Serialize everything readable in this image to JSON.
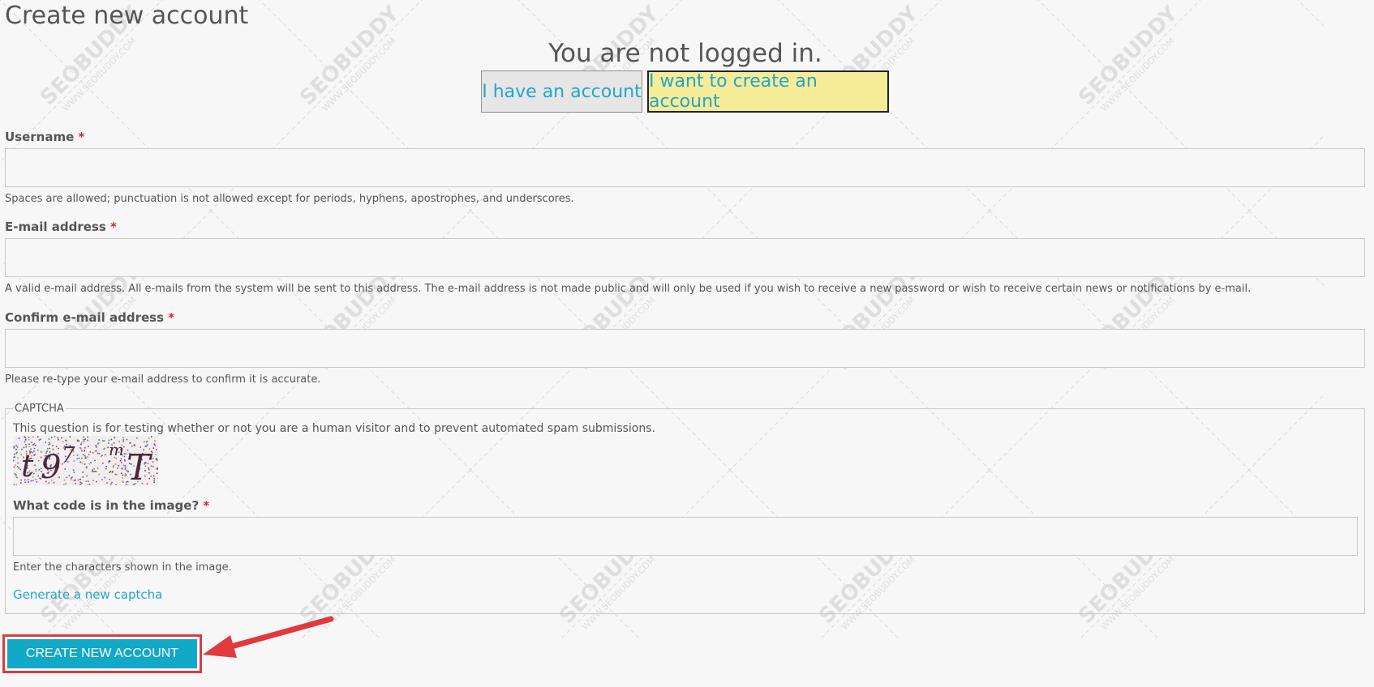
{
  "page": {
    "title": "Create new account"
  },
  "login_status": "You are not logged in.",
  "account_toggle": {
    "have_account": "I have an account",
    "create_account": "I want to create an account"
  },
  "form": {
    "username": {
      "label": "Username",
      "required_mark": "*",
      "value": "",
      "description": "Spaces are allowed; punctuation is not allowed except for periods, hyphens, apostrophes, and underscores."
    },
    "email": {
      "label": "E-mail address",
      "required_mark": "*",
      "value": "",
      "description": "A valid e-mail address. All e-mails from the system will be sent to this address. The e-mail address is not made public and will only be used if you wish to receive a new password or wish to receive certain news or notifications by e-mail."
    },
    "confirm_email": {
      "label": "Confirm e-mail address",
      "required_mark": "*",
      "value": "",
      "description": "Please re-type your e-mail address to confirm it is accurate."
    },
    "captcha": {
      "legend": "CAPTCHA",
      "intro": "This question is for testing whether or not you are a human visitor and to prevent automated spam submissions.",
      "image_text": "t97 m T",
      "code_label": "What code is in the image?",
      "required_mark": "*",
      "value": "",
      "description": "Enter the characters shown in the image.",
      "regenerate_link": "Generate a new captcha"
    },
    "submit_label": "CREATE NEW ACCOUNT"
  },
  "watermark": {
    "brand": "SEOBUDDY",
    "url": "WWW.SEOBUDDY.COM"
  },
  "colors": {
    "accent": "#22a7c9",
    "submit_bg": "#12a8c7",
    "highlight": "#f6ec98",
    "required": "#e02424",
    "annotation_red": "#e03a3e"
  }
}
